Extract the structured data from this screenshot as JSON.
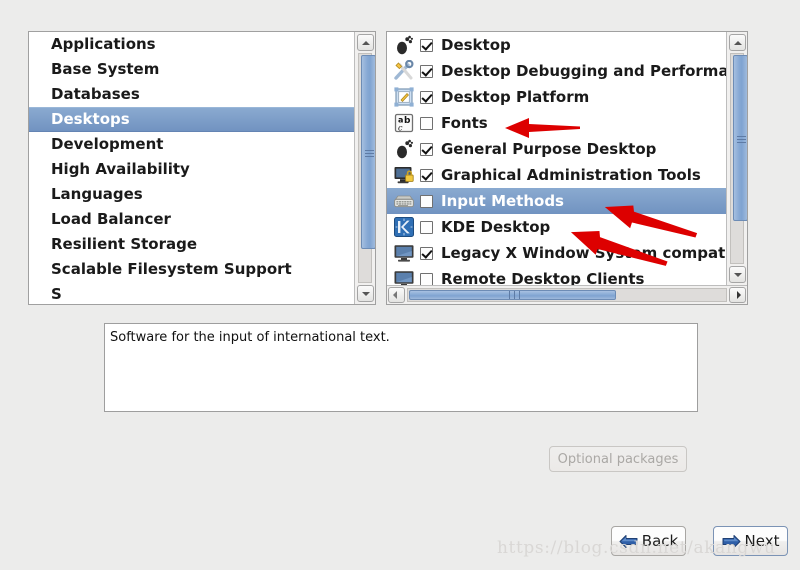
{
  "window": {
    "background_color": "#ececeb"
  },
  "categories": {
    "selected": "Desktops",
    "items": [
      {
        "label": "Applications",
        "selected": false
      },
      {
        "label": "Base System",
        "selected": false
      },
      {
        "label": "Databases",
        "selected": false
      },
      {
        "label": "Desktops",
        "selected": true
      },
      {
        "label": "Development",
        "selected": false
      },
      {
        "label": "High Availability",
        "selected": false
      },
      {
        "label": "Languages",
        "selected": false
      },
      {
        "label": "Load Balancer",
        "selected": false
      },
      {
        "label": "Resilient Storage",
        "selected": false
      },
      {
        "label": "Scalable Filesystem Support",
        "selected": false
      },
      {
        "label": "S",
        "selected": false
      }
    ]
  },
  "groups": {
    "selected": "Input Methods",
    "items": [
      {
        "label": "Desktop",
        "checked": true,
        "selected": false,
        "icon": "gnome-foot-icon"
      },
      {
        "label": "Desktop Debugging and Performa",
        "checked": true,
        "selected": false,
        "icon": "tools-icon"
      },
      {
        "label": "Desktop Platform",
        "checked": true,
        "selected": false,
        "icon": "desktop-platform-icon"
      },
      {
        "label": "Fonts",
        "checked": false,
        "selected": false,
        "icon": "fonts-abc-icon"
      },
      {
        "label": "General Purpose Desktop",
        "checked": true,
        "selected": false,
        "icon": "gnome-foot-icon"
      },
      {
        "label": "Graphical Administration Tools",
        "checked": true,
        "selected": false,
        "icon": "monitor-lock-icon"
      },
      {
        "label": "Input Methods",
        "checked": false,
        "selected": true,
        "icon": "keyboard-icon"
      },
      {
        "label": "KDE Desktop",
        "checked": false,
        "selected": false,
        "icon": "kde-logo-icon"
      },
      {
        "label": "Legacy X Window System compat",
        "checked": true,
        "selected": false,
        "icon": "monitor-icon"
      },
      {
        "label": "Remote Desktop Clients",
        "checked": false,
        "selected": false,
        "icon": "monitor-icon"
      }
    ]
  },
  "description": {
    "text": "Software for the input of international text."
  },
  "buttons": {
    "optional_packages": {
      "label": "Optional packages",
      "enabled": false
    },
    "back": {
      "label": "Back",
      "icon": "left-arrow-icon"
    },
    "next": {
      "label": "Next",
      "icon": "right-arrow-icon"
    }
  },
  "watermark": {
    "text": "https://blog.csdn.net/akangwu"
  },
  "annotations": {
    "arrow_color": "#dd0000",
    "arrows": [
      {
        "target": "Fonts",
        "direction": "left"
      },
      {
        "target": "Input Methods",
        "direction": "up-left"
      },
      {
        "target": "KDE Desktop",
        "direction": "up-left"
      }
    ]
  },
  "colors": {
    "selection_blue": "#7a9cc6",
    "panel_background": "#ffffff",
    "window_background": "#ececeb"
  }
}
